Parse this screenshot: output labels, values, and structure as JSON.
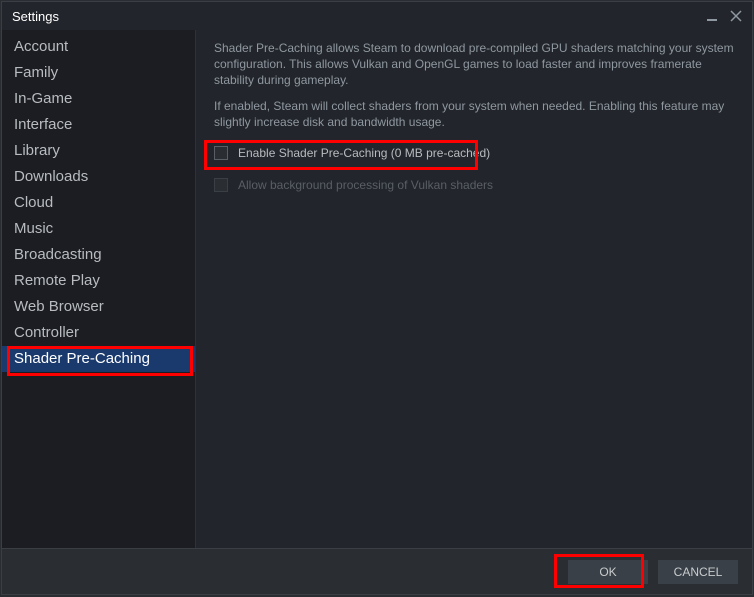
{
  "window": {
    "title": "Settings"
  },
  "sidebar": {
    "items": [
      {
        "label": "Account"
      },
      {
        "label": "Family"
      },
      {
        "label": "In-Game"
      },
      {
        "label": "Interface"
      },
      {
        "label": "Library"
      },
      {
        "label": "Downloads"
      },
      {
        "label": "Cloud"
      },
      {
        "label": "Music"
      },
      {
        "label": "Broadcasting"
      },
      {
        "label": "Remote Play"
      },
      {
        "label": "Web Browser"
      },
      {
        "label": "Controller"
      },
      {
        "label": "Shader Pre-Caching"
      }
    ],
    "selected_index": 12
  },
  "content": {
    "description1": "Shader Pre-Caching allows Steam to download pre-compiled GPU shaders matching your system configuration. This allows Vulkan and OpenGL games to load faster and improves framerate stability during gameplay.",
    "description2": "If enabled, Steam will collect shaders from your system when needed. Enabling this feature may slightly increase disk and bandwidth usage.",
    "option_enable": "Enable Shader Pre-Caching (0 MB pre-cached)",
    "option_background": "Allow background processing of Vulkan shaders"
  },
  "footer": {
    "ok": "OK",
    "cancel": "CANCEL"
  }
}
